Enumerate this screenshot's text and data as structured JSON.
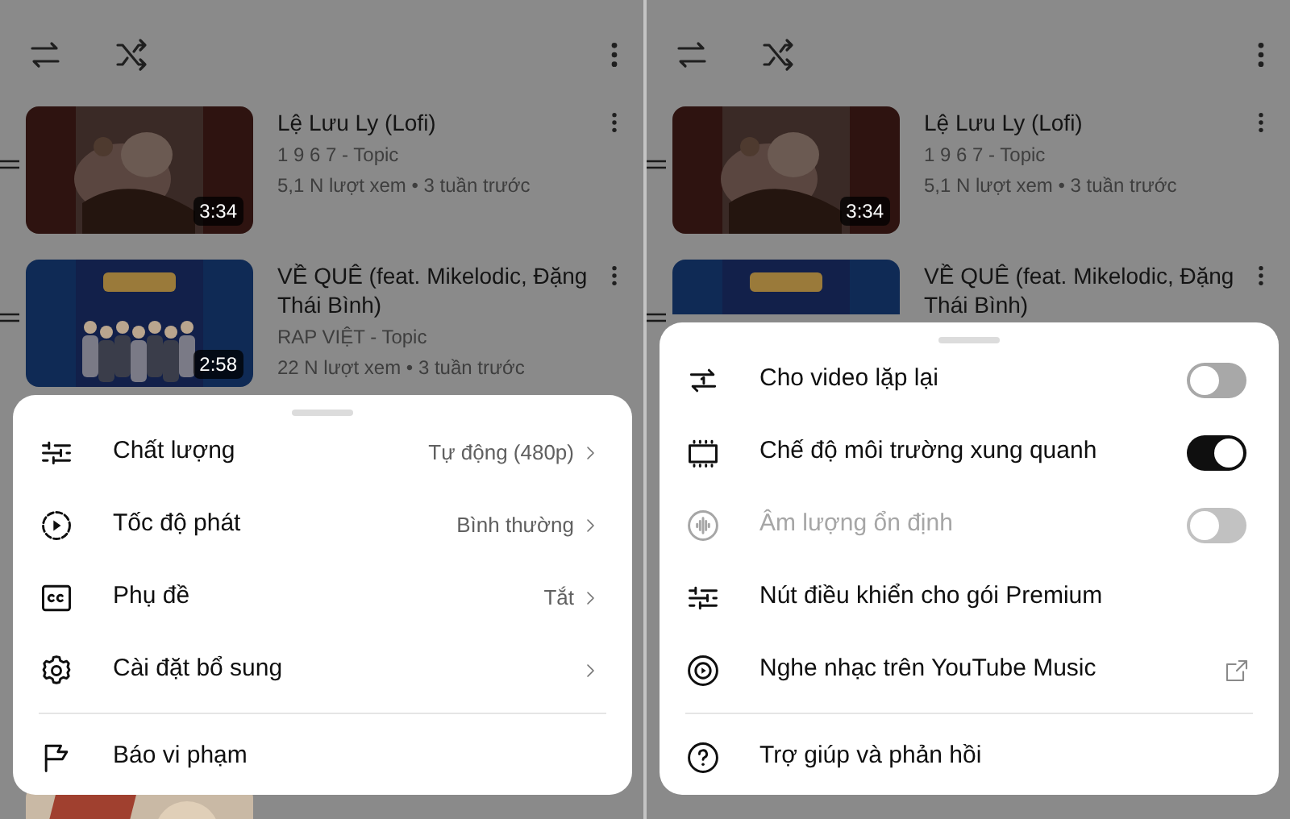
{
  "panels": [
    {
      "videos": [
        {
          "title": "Lệ Lưu Ly (Lofi)",
          "channel": "1 9 6 7 - Topic",
          "meta": "5,1 N lượt xem • 3 tuần trước",
          "duration": "3:34"
        },
        {
          "title": "VỀ QUÊ (feat. Mikelodic, Đặng Thái Bình)",
          "channel": "RAP VIỆT - Topic",
          "meta": "22 N lượt xem • 3 tuần trước",
          "duration": "2:58"
        }
      ],
      "sheet": {
        "items": [
          {
            "kind": "nav",
            "label": "Chất lượng",
            "value": "Tự động (480p)"
          },
          {
            "kind": "nav",
            "label": "Tốc độ phát",
            "value": "Bình thường"
          },
          {
            "kind": "nav",
            "label": "Phụ đề",
            "value": "Tắt"
          },
          {
            "kind": "nav",
            "label": "Cài đặt bổ sung"
          }
        ],
        "footer": [
          {
            "kind": "action",
            "label": "Báo vi phạm"
          }
        ]
      }
    },
    {
      "videos": [
        {
          "title": "Lệ Lưu Ly (Lofi)",
          "channel": "1 9 6 7 - Topic",
          "meta": "5,1 N lượt xem • 3 tuần trước",
          "duration": "3:34"
        },
        {
          "title": "VỀ QUÊ (feat. Mikelodic, Đặng Thái Bình)"
        }
      ],
      "sheet": {
        "items": [
          {
            "kind": "toggle",
            "label": "Cho video lặp lại",
            "on": false,
            "disabled": false
          },
          {
            "kind": "toggle",
            "label": "Chế độ môi trường xung quanh",
            "on": true,
            "disabled": false
          },
          {
            "kind": "toggle",
            "label": "Âm lượng ổn định",
            "on": false,
            "disabled": true
          },
          {
            "kind": "action",
            "label": "Nút điều khiển cho gói Premium"
          },
          {
            "kind": "link",
            "label": "Nghe nhạc trên YouTube Music"
          }
        ],
        "footer": [
          {
            "kind": "action",
            "label": "Trợ giúp và phản hồi"
          }
        ]
      }
    }
  ]
}
